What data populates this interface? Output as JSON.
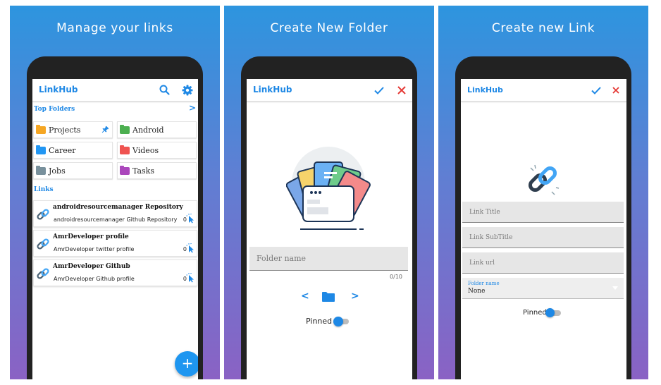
{
  "panels": [
    {
      "title": "Manage your links"
    },
    {
      "title": "Create New Folder"
    },
    {
      "title": "Create new Link"
    }
  ],
  "app": {
    "name": "LinkHub",
    "accent": "#1e88e5",
    "icons": {
      "search": "search-icon",
      "settings": "gear-icon",
      "confirm": "check-icon",
      "close": "close-icon",
      "add": "plus-icon"
    }
  },
  "home": {
    "top_folders_label": "Top Folders",
    "more_arrow": ">",
    "folders": [
      {
        "name": "Projects",
        "color": "#f5a623",
        "pinned": true
      },
      {
        "name": "Android",
        "color": "#4caf50",
        "pinned": false
      },
      {
        "name": "Career",
        "color": "#2196f3",
        "pinned": false
      },
      {
        "name": "Videos",
        "color": "#ef5350",
        "pinned": false
      },
      {
        "name": "Jobs",
        "color": "#78909c",
        "pinned": false
      },
      {
        "name": "Tasks",
        "color": "#ab47bc",
        "pinned": false
      }
    ],
    "links_label": "Links",
    "links": [
      {
        "title": "androidresourcemanager Repository",
        "subtitle": "androidresourcemanager Github Repository",
        "count": "0"
      },
      {
        "title": "AmrDeveloper profile",
        "subtitle": "AmrDeveloper twitter profile",
        "count": "0"
      },
      {
        "title": "AmrDeveloper Github",
        "subtitle": "AmrDeveloper Github profile",
        "count": "0"
      }
    ],
    "fab_label": "+"
  },
  "create_folder": {
    "folder_name_placeholder": "Folder name",
    "char_counter": "0/10",
    "prev_color": "<",
    "next_color": ">",
    "pinned_label": "Pinned",
    "pinned": false
  },
  "create_link": {
    "link_title_placeholder": "Link Title",
    "link_subtitle_placeholder": "Link SubTitle",
    "link_url_placeholder": "Link url",
    "folder_select_label": "Folder name",
    "folder_select_value": "None",
    "pinned_label": "Pinned",
    "pinned": false
  }
}
